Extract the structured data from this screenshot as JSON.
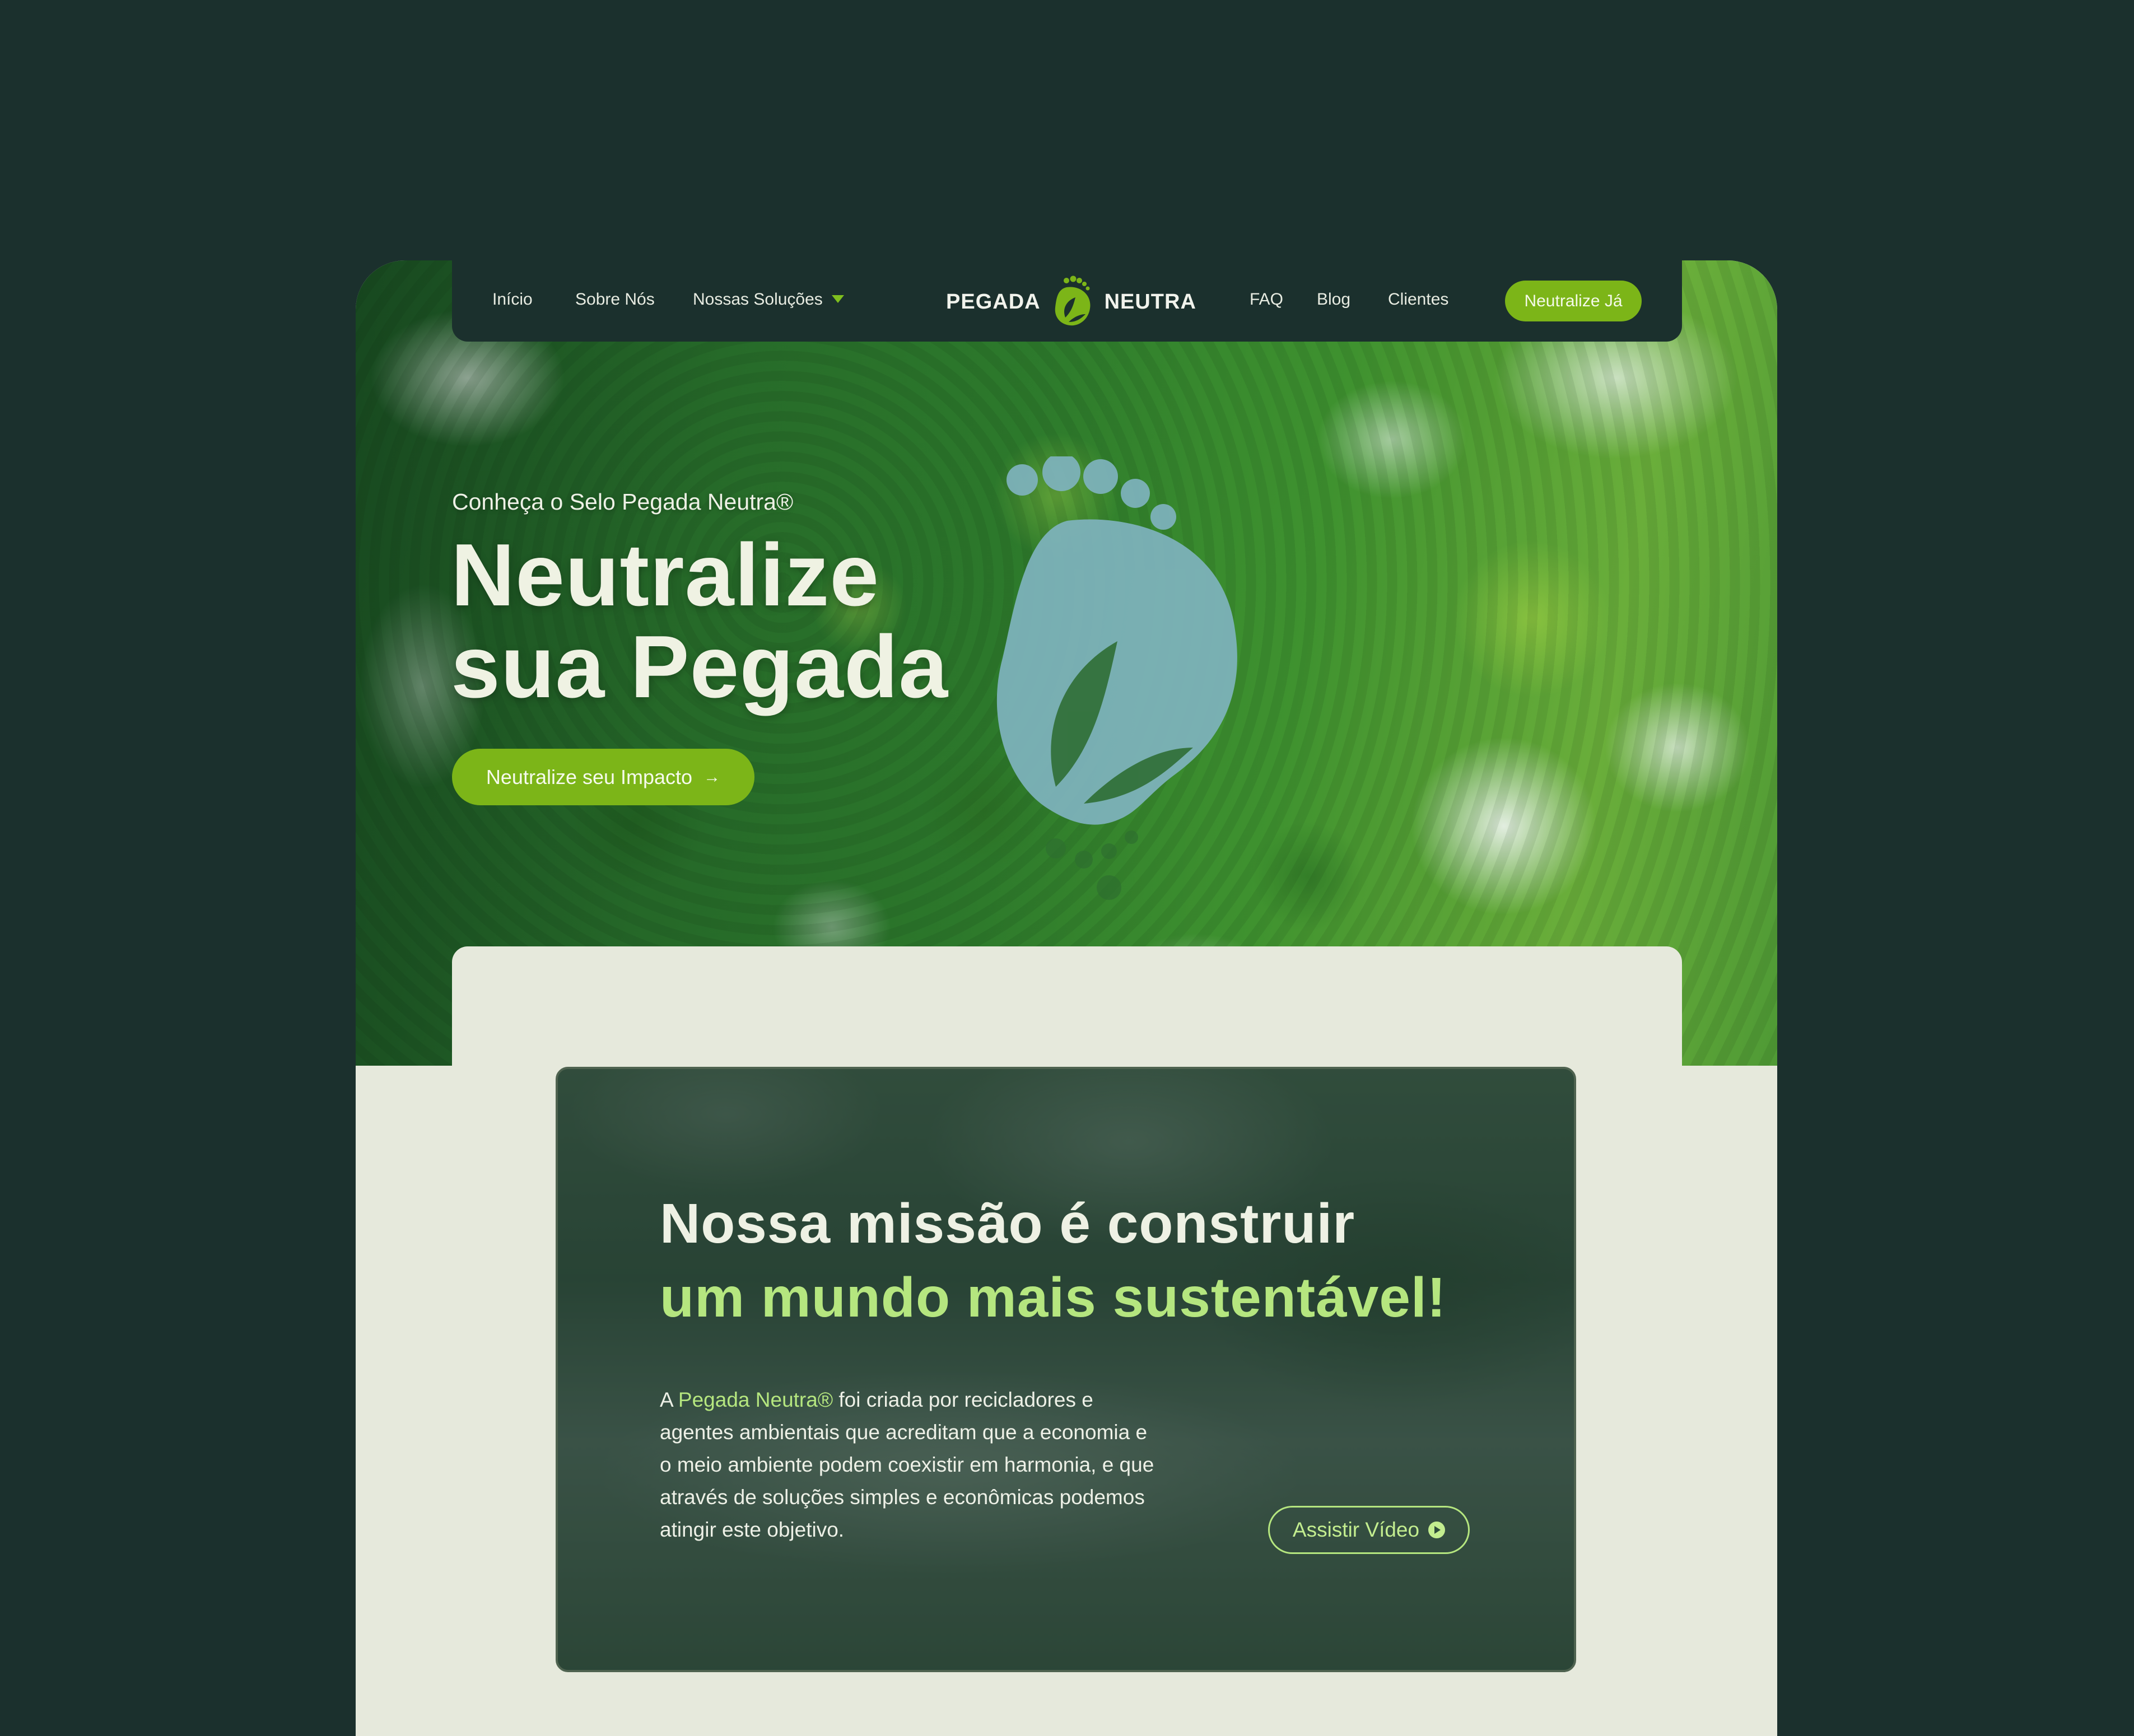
{
  "nav": {
    "left_items": [
      {
        "label": "Início"
      },
      {
        "label": "Sobre Nós"
      },
      {
        "label": "Nossas Soluções",
        "has_dropdown": true
      }
    ],
    "logo": {
      "left_word": "PEGADA",
      "right_word": "NEUTRA",
      "icon": "footprint-leaf-icon"
    },
    "right_items": [
      {
        "label": "FAQ"
      },
      {
        "label": "Blog"
      },
      {
        "label": "Clientes"
      }
    ],
    "cta_label": "Neutralize Já"
  },
  "hero": {
    "eyebrow": "Conheça o Selo Pegada Neutra®",
    "headline_line1": "Neutralize",
    "headline_line2": "sua Pegada",
    "cta_label": "Neutralize seu Impacto",
    "cta_icon": "arrow-right-icon",
    "background": "aerial forest with footprint-shaped lake"
  },
  "mission": {
    "title_line1": "Nossa missão é construir",
    "title_line2": "um mundo mais sustentável!",
    "body_prefix": "A ",
    "body_highlight": "Pegada Neutra®",
    "body_rest": " foi criada por recicladores e agentes ambientais que acreditam que a economia e o meio ambiente podem coexistir em harmonia, e que através de soluções simples e econômicas podemos atingir este objetivo.",
    "video_label": "Assistir Vídeo",
    "video_icon": "play-circle-icon"
  },
  "colors": {
    "background": "#1b302d",
    "accent": "#7cb518",
    "highlight": "#b5e67f",
    "panel": "#e6e9dc"
  }
}
